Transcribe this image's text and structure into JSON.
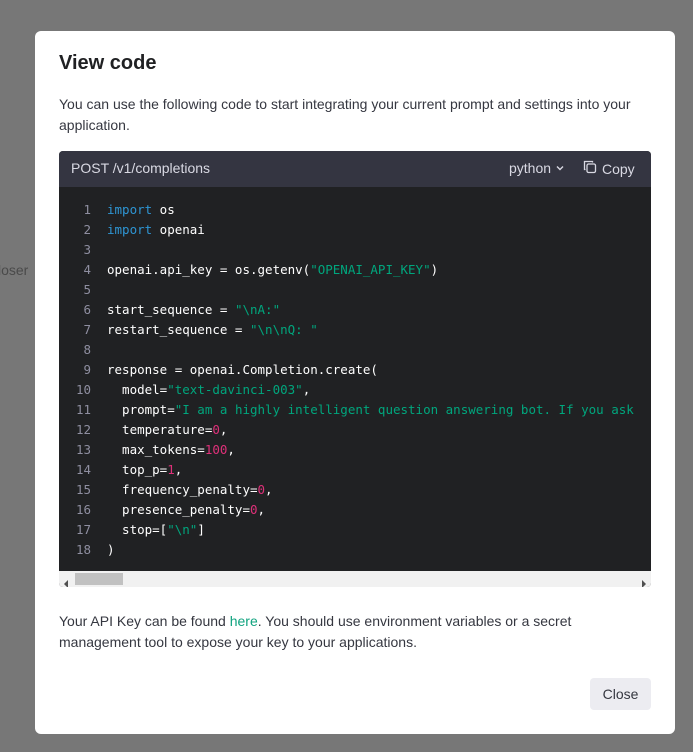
{
  "background": {
    "partial_text": "loser"
  },
  "modal": {
    "title": "View code",
    "description": "You can use the following code to start integrating your current prompt and settings into your application.",
    "code_header": {
      "endpoint": "POST /v1/completions",
      "language": "python",
      "copy_label": "Copy"
    },
    "code_lines": [
      {
        "n": "1",
        "tokens": [
          {
            "t": "import",
            "c": "kw"
          },
          {
            "t": " os",
            "c": ""
          }
        ]
      },
      {
        "n": "2",
        "tokens": [
          {
            "t": "import",
            "c": "kw"
          },
          {
            "t": " openai",
            "c": ""
          }
        ]
      },
      {
        "n": "3",
        "tokens": []
      },
      {
        "n": "4",
        "tokens": [
          {
            "t": "openai.api_key = os.getenv(",
            "c": ""
          },
          {
            "t": "\"OPENAI_API_KEY\"",
            "c": "str"
          },
          {
            "t": ")",
            "c": ""
          }
        ]
      },
      {
        "n": "5",
        "tokens": []
      },
      {
        "n": "6",
        "tokens": [
          {
            "t": "start_sequence = ",
            "c": ""
          },
          {
            "t": "\"\\nA:\"",
            "c": "str"
          }
        ]
      },
      {
        "n": "7",
        "tokens": [
          {
            "t": "restart_sequence = ",
            "c": ""
          },
          {
            "t": "\"\\n\\nQ: \"",
            "c": "str"
          }
        ]
      },
      {
        "n": "8",
        "tokens": []
      },
      {
        "n": "9",
        "tokens": [
          {
            "t": "response = openai.Completion.create(",
            "c": ""
          }
        ]
      },
      {
        "n": "10",
        "tokens": [
          {
            "t": "  model=",
            "c": ""
          },
          {
            "t": "\"text-davinci-003\"",
            "c": "str"
          },
          {
            "t": ",",
            "c": ""
          }
        ]
      },
      {
        "n": "11",
        "tokens": [
          {
            "t": "  prompt=",
            "c": ""
          },
          {
            "t": "\"I am a highly intelligent question answering bot. If you ask",
            "c": "str"
          }
        ]
      },
      {
        "n": "12",
        "tokens": [
          {
            "t": "  temperature=",
            "c": ""
          },
          {
            "t": "0",
            "c": "num"
          },
          {
            "t": ",",
            "c": ""
          }
        ]
      },
      {
        "n": "13",
        "tokens": [
          {
            "t": "  max_tokens=",
            "c": ""
          },
          {
            "t": "100",
            "c": "num"
          },
          {
            "t": ",",
            "c": ""
          }
        ]
      },
      {
        "n": "14",
        "tokens": [
          {
            "t": "  top_p=",
            "c": ""
          },
          {
            "t": "1",
            "c": "num"
          },
          {
            "t": ",",
            "c": ""
          }
        ]
      },
      {
        "n": "15",
        "tokens": [
          {
            "t": "  frequency_penalty=",
            "c": ""
          },
          {
            "t": "0",
            "c": "num"
          },
          {
            "t": ",",
            "c": ""
          }
        ]
      },
      {
        "n": "16",
        "tokens": [
          {
            "t": "  presence_penalty=",
            "c": ""
          },
          {
            "t": "0",
            "c": "num"
          },
          {
            "t": ",",
            "c": ""
          }
        ]
      },
      {
        "n": "17",
        "tokens": [
          {
            "t": "  stop=[",
            "c": ""
          },
          {
            "t": "\"\\n\"",
            "c": "str"
          },
          {
            "t": "]",
            "c": ""
          }
        ]
      },
      {
        "n": "18",
        "tokens": [
          {
            "t": ")",
            "c": ""
          }
        ]
      }
    ],
    "footer": {
      "before_link": "Your API Key can be found ",
      "link_text": "here",
      "after_link": ". You should use environment variables or a secret management tool to expose your key to your applications."
    },
    "close_label": "Close"
  },
  "colors": {
    "keyword": "#2e95d3",
    "string": "#00a67d",
    "number": "#df3079",
    "link": "#10a37f",
    "code_bg": "#202123",
    "code_header_bg": "#343541"
  },
  "icons": {
    "language_dropdown": "chevron-down-icon",
    "copy": "copy-icon",
    "scroll_left": "scroll-left-arrow-icon",
    "scroll_right": "scroll-right-arrow-icon"
  }
}
